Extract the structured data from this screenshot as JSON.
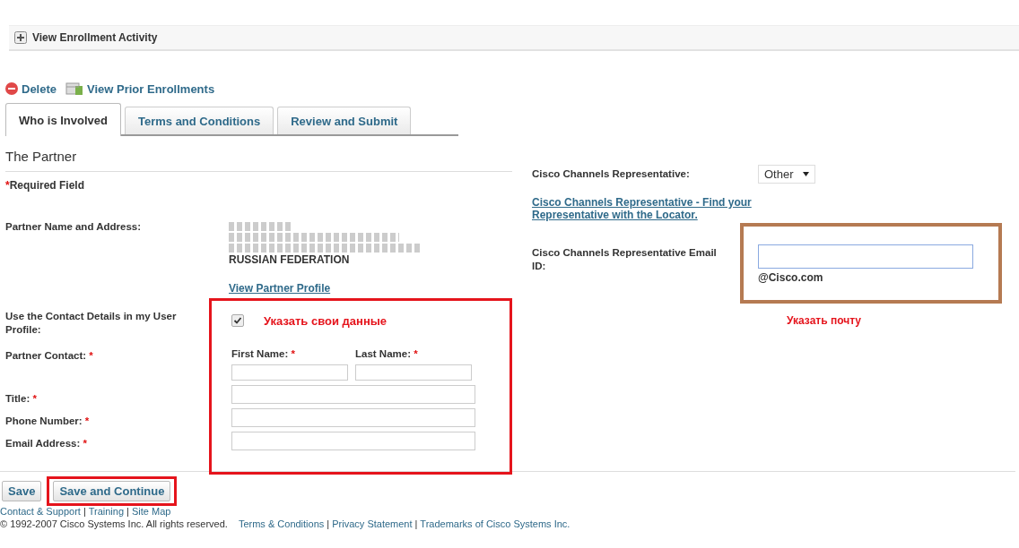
{
  "enrollment_activity": {
    "label": "View Enrollment Activity",
    "expanded": false
  },
  "actions": [
    {
      "label": "Delete",
      "kind": "delete"
    },
    {
      "label": "View Prior Enrollments",
      "kind": "history"
    }
  ],
  "tabs": [
    {
      "label": "Who is Involved",
      "selected": true
    },
    {
      "label": "Terms and Conditions",
      "selected": false
    },
    {
      "label": "Review and Submit",
      "selected": false
    }
  ],
  "section_title": "The Partner",
  "required_mark": "*",
  "required_note": "Required Field",
  "partner": {
    "label": "Partner Name and Address:",
    "address_lines": [
      "RUSSIAN FEDERATION"
    ],
    "profile_link": "View Partner Profile"
  },
  "use_profile": {
    "label": "Use the Contact Details in my User Profile:",
    "checked": true,
    "annotation": "Указать свои данные"
  },
  "contact": {
    "label": "Partner Contact:",
    "required": true,
    "first_name_label": "First Name:",
    "last_name_label": "Last Name:"
  },
  "fields": [
    {
      "label": "Title:",
      "required": true
    },
    {
      "label": "Phone Number:",
      "required": true
    },
    {
      "label": "Email Address:",
      "required": true
    }
  ],
  "representative": {
    "label": "Cisco Channels Representative:",
    "value": "Other",
    "locator_link": "Cisco Channels Representative - Find your Representative with the Locator.",
    "email_label": "Cisco Channels Representative Email ID:",
    "email_suffix": "@Cisco.com",
    "annotation": "Указать почту"
  },
  "buttons": [
    {
      "label": "Save",
      "highlighted": false
    },
    {
      "label": "Save and Continue",
      "highlighted": true
    }
  ],
  "footer": {
    "separator": "|",
    "links": [
      "Contact & Support",
      "Training",
      "Site Map"
    ],
    "copyright": "© 1992-2007 Cisco Systems Inc. All rights reserved.",
    "legal_links": [
      "Terms & Conditions",
      "Privacy Statement",
      "Trademarks of Cisco Systems Inc."
    ]
  }
}
